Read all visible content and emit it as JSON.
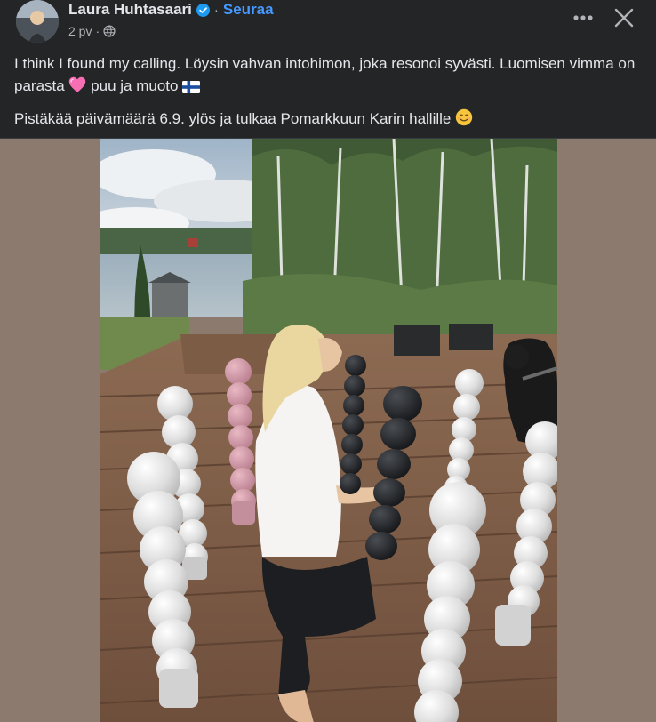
{
  "post": {
    "author_name": "Laura Huhtasaari",
    "separator": "·",
    "follow_label": "Seuraa",
    "time_ago": "2 pv",
    "meta_separator": "·",
    "paragraph1_part1": "I think I found my calling. Löysin vahvan intohimon, joka resonoi syvästi. Luomisen vimma on parasta ",
    "paragraph1_part2": " puu ja muoto ",
    "paragraph2_text": "Pistäkää päivämäärä 6.9. ylös ja tulkaa Pomarkkuun Karin hallille ",
    "emoji": {
      "heart": "pink-heart",
      "flag": "finland-flag",
      "smile": "smiling-face"
    }
  },
  "icons": {
    "verified": "verified-badge-icon",
    "audience": "globe-icon",
    "more": "more-options-icon",
    "close": "close-icon"
  },
  "colors": {
    "background": "#242526",
    "text_primary": "#e4e6eb",
    "text_secondary": "#b0b3b8",
    "link": "#4599ff",
    "verified": "#1d9bf0",
    "media_backdrop": "#8b7a6d"
  }
}
